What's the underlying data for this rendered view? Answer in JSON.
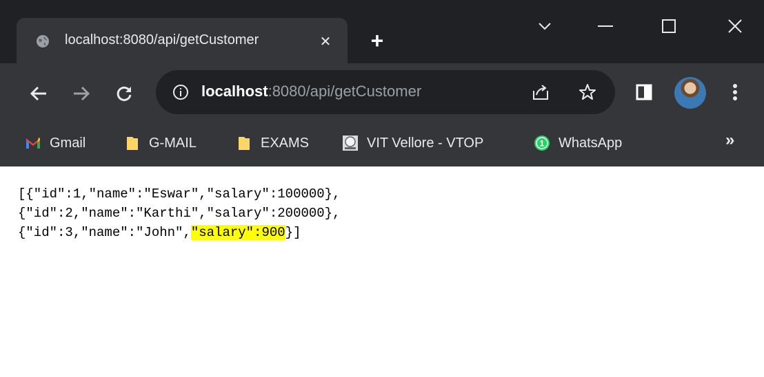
{
  "tab": {
    "title": "localhost:8080/api/getCustomer",
    "close_glyph": "✕",
    "favicon": "globe-icon"
  },
  "new_tab_glyph": "+",
  "window_controls": [
    "chevron-down-icon",
    "minimize-icon",
    "maximize-icon",
    "close-icon"
  ],
  "toolbar": {
    "url_host": "localhost",
    "url_rest": ":8080/api/getCustomer",
    "icons": [
      "back-icon",
      "forward-icon",
      "reload-icon",
      "info-icon",
      "share-icon",
      "star-icon",
      "side-panel-icon",
      "menu-icon"
    ]
  },
  "bookmarks": {
    "items": [
      {
        "label": "Gmail",
        "icon": "gmail-icon"
      },
      {
        "label": "G-MAIL",
        "icon": "folder-icon"
      },
      {
        "label": "EXAMS",
        "icon": "folder-icon"
      },
      {
        "label": "VIT Vellore - VTOP",
        "icon": "site-icon"
      },
      {
        "label": "WhatsApp",
        "icon": "whatsapp-icon"
      }
    ],
    "overflow": "»",
    "whatsapp_badge": "1"
  },
  "content": {
    "line1": "[{\"id\":1,\"name\":\"Eswar\",\"salary\":100000},",
    "line2": "{\"id\":2,\"name\":\"Karthi\",\"salary\":200000},",
    "line3_pre": "{\"id\":3,\"name\":\"John\",",
    "line3_highlight": "\"salary\":900",
    "line3_post": "}]"
  },
  "colors": {
    "titlebar": "#202124",
    "toolbar": "#35363a",
    "highlight": "#ffff00"
  }
}
